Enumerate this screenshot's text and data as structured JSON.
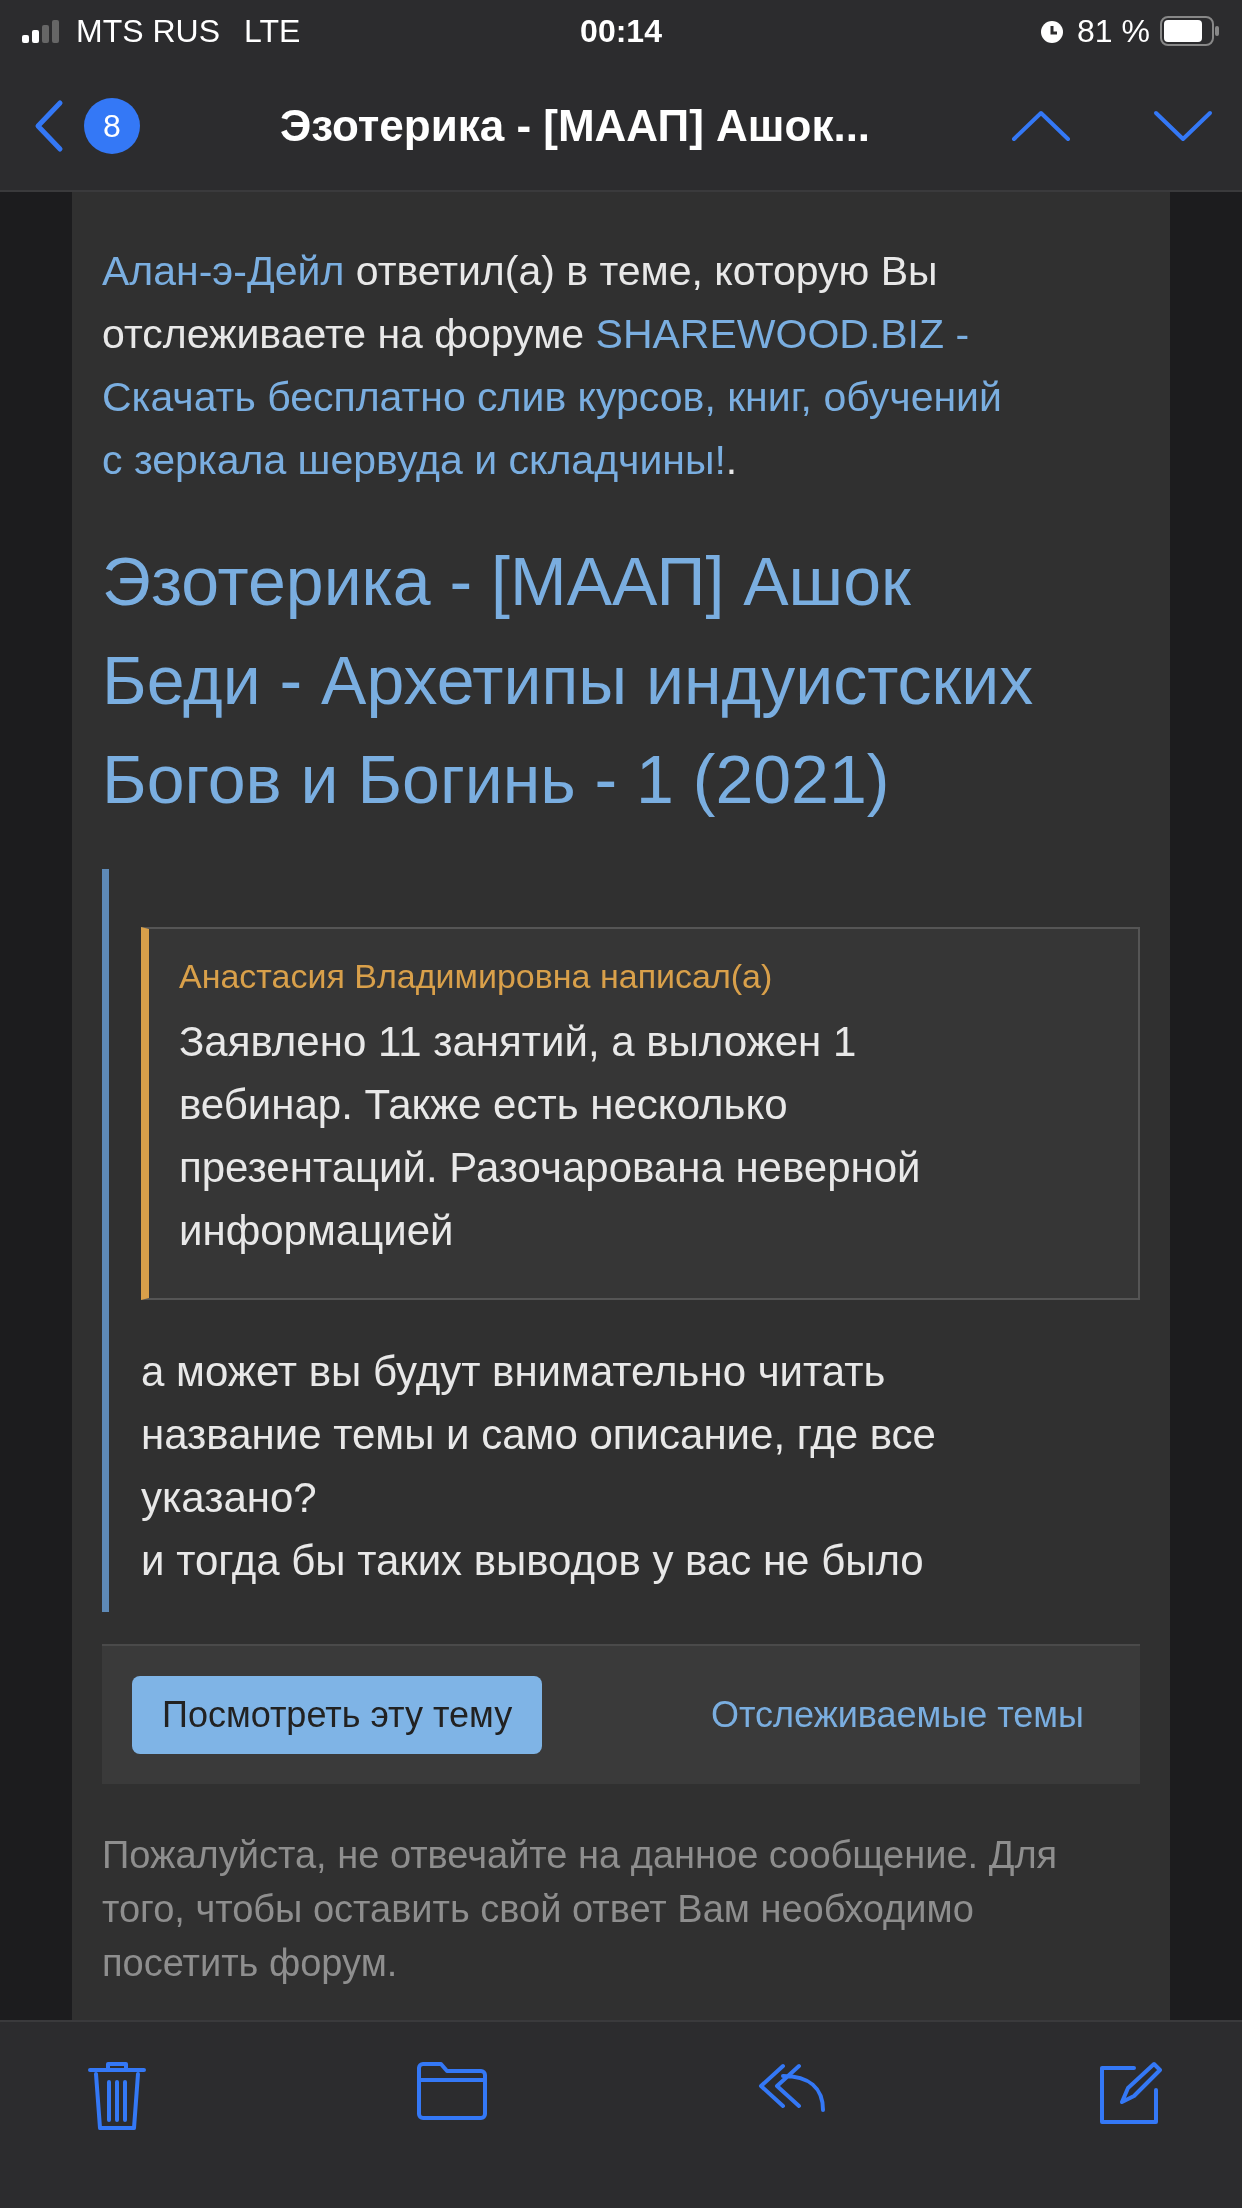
{
  "status_bar": {
    "carrier": "MTS RUS",
    "network": "LTE",
    "time": "00:14",
    "battery": "81 %"
  },
  "nav": {
    "badge": "8",
    "title": "Эзотерика - [МААП] Ашок..."
  },
  "intro": [
    {
      "kind": "link",
      "text": "Алан-э-Дейл"
    },
    {
      "kind": "text",
      "text": " ответил(а) в теме, которую Вы отслеживаете на форуме "
    },
    {
      "kind": "link",
      "text": "SHAREWOOD.BIZ -"
    },
    {
      "kind": "link",
      "text": "Скачать бесплатно слив курсов, книг, обучений"
    },
    {
      "kind": "link",
      "text": "с зеркала шервуда и складчины!"
    },
    {
      "kind": "text",
      "text": "."
    }
  ],
  "topic_title": "Эзотерика - [МААП] Ашок Беди - Архетипы индуистских Богов и Богинь - 1 (2021)",
  "post": {
    "quote": {
      "author": "Анастасия Владимировна написал(а)",
      "text": "Заявлено 11 занятий, а выложен 1 вебинар. Также есть несколько презентаций. Разочарована неверной информацией"
    },
    "paragraphs": [
      "а может вы будут внимательно читать название темы и само описание, где все указано?",
      "и тогда бы таких выводов у вас не было"
    ]
  },
  "actions": [
    {
      "kind": "button",
      "label": "Посмотреть эту тему"
    },
    {
      "kind": "link",
      "label": "Отслеживаемые темы"
    }
  ],
  "footer": "Пожалуйста, не отвечайте на данное сообщение. Для того, чтобы оставить свой ответ Вам необходимо посетить форум.",
  "toolbar": [
    {
      "kind": "trash"
    },
    {
      "kind": "folder"
    },
    {
      "kind": "reply"
    },
    {
      "kind": "compose"
    }
  ]
}
